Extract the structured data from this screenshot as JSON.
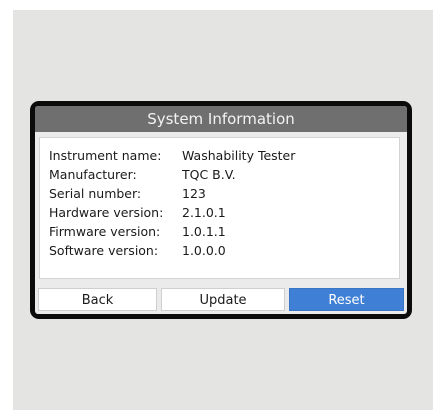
{
  "screen": {
    "title": "System Information"
  },
  "info": [
    {
      "label": "Instrument name:",
      "value": "Washability Tester"
    },
    {
      "label": "Manufacturer:",
      "value": "TQC B.V."
    },
    {
      "label": "Serial number:",
      "value": "123"
    },
    {
      "label": "Hardware version:",
      "value": "2.1.0.1"
    },
    {
      "label": "Firmware version:",
      "value": "1.0.1.1"
    },
    {
      "label": "Software version:",
      "value": "1.0.0.0"
    }
  ],
  "buttons": {
    "back": "Back",
    "update": "Update",
    "reset": "Reset"
  },
  "colors": {
    "title_bar": "#6f6f6f",
    "reset_button": "#3f7fd6",
    "bezel": "#0b0b0b"
  }
}
